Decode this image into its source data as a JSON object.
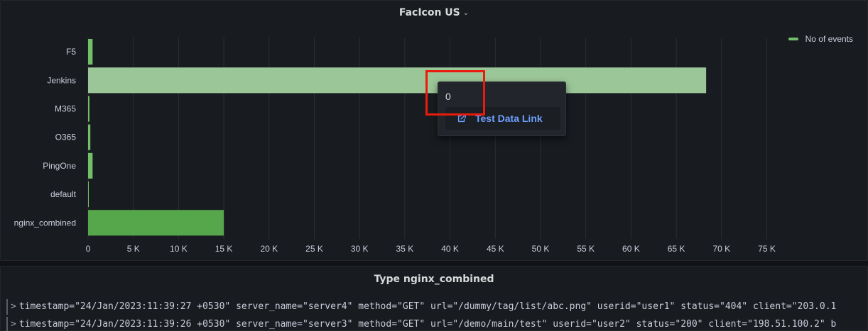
{
  "top_panel": {
    "title": "FacIcon US",
    "chevron_icon": "chevron-down-icon"
  },
  "chart_data": {
    "type": "bar",
    "orientation": "horizontal",
    "categories": [
      "F5",
      "Jenkins",
      "M365",
      "O365",
      "PingOne",
      "default",
      "nginx_combined"
    ],
    "series": [
      {
        "name": "No of events",
        "values": [
          500,
          68300,
          150,
          250,
          500,
          60,
          15000
        ]
      }
    ],
    "xlim": [
      0,
      77000
    ],
    "ticks": [
      0,
      5000,
      10000,
      15000,
      20000,
      25000,
      30000,
      35000,
      40000,
      45000,
      50000,
      55000,
      60000,
      65000,
      70000,
      75000
    ],
    "tick_labels": [
      "0",
      "5 K",
      "10 K",
      "15 K",
      "20 K",
      "25 K",
      "30 K",
      "35 K",
      "40 K",
      "45 K",
      "50 K",
      "55 K",
      "60 K",
      "65 K",
      "70 K",
      "75 K"
    ],
    "grid": true,
    "legend_placement": "top-right",
    "bar_colors": [
      "#73bf69",
      "#9bc698",
      "#73bf69",
      "#73bf69",
      "#73bf69",
      "#73bf69",
      "#56a64b"
    ],
    "legend_color": "#73bf69"
  },
  "tooltip": {
    "value": "0",
    "link_label": "Test Data Link",
    "link_icon": "external-link-icon",
    "highlight_color": "#e81b0c"
  },
  "bottom_panel": {
    "title": "Type nginx_combined",
    "log_lines": [
      "timestamp=\"24/Jan/2023:11:39:27 +0530\" server_name=\"server4\" method=\"GET\" url=\"/dummy/tag/list/abc.png\" userid=\"user1\" status=\"404\" client=\"203.0.1",
      "timestamp=\"24/Jan/2023:11:39:26 +0530\" server_name=\"server3\" method=\"GET\" url=\"/demo/main/test\" userid=\"user2\" status=\"200\" client=\"198.51.100.2\" b"
    ]
  }
}
